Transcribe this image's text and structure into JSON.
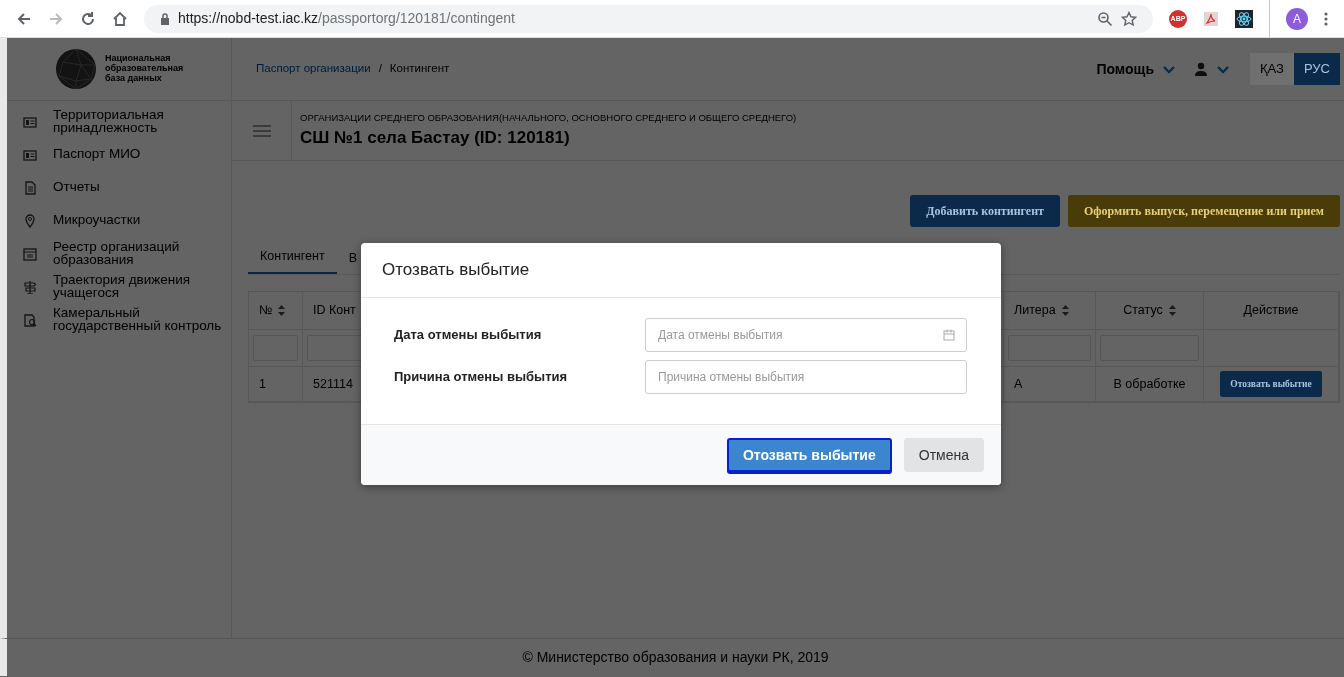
{
  "browser": {
    "url_host": "https://nobd-test.iac.kz",
    "url_path": "/passportorg/120181/contingent",
    "extension_label": "ABP",
    "profile_initial": "A"
  },
  "logo": {
    "lines": [
      "Национальная",
      "образовательная",
      "база данных"
    ]
  },
  "sidebar": {
    "items": [
      {
        "label": "Территориальная принадлежность"
      },
      {
        "label": "Паспорт МИО"
      },
      {
        "label": "Отчеты"
      },
      {
        "label": "Микроучастки"
      },
      {
        "label": "Реестр организаций образования"
      },
      {
        "label": "Траектория движения учащегося"
      },
      {
        "label": "Камеральный государственный контроль"
      }
    ]
  },
  "breadcrumb": {
    "items": [
      {
        "label": "Паспорт организации",
        "link": true
      },
      {
        "label": "Контингент",
        "link": false
      }
    ],
    "separator": "/"
  },
  "header": {
    "help": "Помощь",
    "languages": [
      {
        "label": "ҚАЗ",
        "selected": false
      },
      {
        "label": "РУС",
        "selected": true
      }
    ]
  },
  "organization": {
    "type": "ОРГАНИЗАЦИИ СРЕДНЕГО ОБРАЗОВАНИЯ(НАЧАЛЬНОГО, ОСНОВНОГО СРЕДНЕГО И ОБЩЕГО СРЕДНЕГО)",
    "title": "СШ №1 села Бастау (ID: 120181)"
  },
  "actions": [
    {
      "label": "Добавить контингент",
      "kind": "primary"
    },
    {
      "label": "Оформить выпуск, перемещение или прием",
      "kind": "warning"
    }
  ],
  "tabs": [
    {
      "label": "Контингент",
      "selected": true
    },
    {
      "label": "В",
      "selected": false
    }
  ],
  "table": {
    "columns": [
      {
        "label": "№",
        "sortable": true
      },
      {
        "label": "ID Конт",
        "sortable": false
      },
      {
        "label": "Литера",
        "sortable": true
      },
      {
        "label": "Статус",
        "sortable": true
      },
      {
        "label": "Действие",
        "sortable": false
      }
    ],
    "rows": [
      {
        "cells": [
          "1",
          "521114",
          "А",
          "В обработке"
        ],
        "action": "Отозвать выбытие"
      }
    ]
  },
  "modal": {
    "title": "Отозвать выбытие",
    "fields": [
      {
        "label": "Дата отмены выбытия",
        "placeholder": "Дата отмены выбытия",
        "kind": "date"
      },
      {
        "label": "Причина отмены выбытия",
        "placeholder": "Причина отмены выбытия",
        "kind": "text"
      }
    ],
    "buttons": [
      {
        "label": "Отозвать выбытие",
        "kind": "primary",
        "focused": true
      },
      {
        "label": "Отмена",
        "kind": "secondary",
        "focused": false
      }
    ]
  },
  "footer": "© Министерство образования и науки РК, 2019"
}
